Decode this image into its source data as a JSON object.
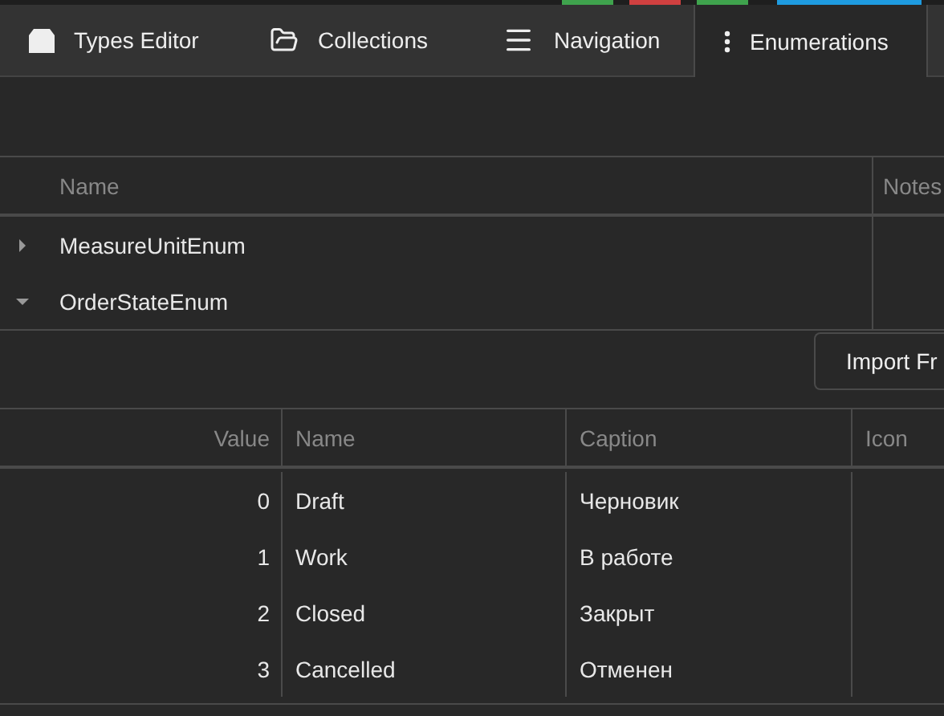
{
  "tabs": [
    {
      "label": "Types Editor",
      "selected": false
    },
    {
      "label": "Collections",
      "selected": false
    },
    {
      "label": "Navigation",
      "selected": false
    },
    {
      "label": "Enumerations",
      "selected": true
    }
  ],
  "enum_table": {
    "columns": [
      "Name",
      "Notes"
    ],
    "rows": [
      {
        "name": "MeasureUnitEnum",
        "expanded": false
      },
      {
        "name": "OrderStateEnum",
        "expanded": true
      }
    ]
  },
  "import_button": "Import Fr",
  "values_table": {
    "columns": [
      "Value",
      "Name",
      "Caption",
      "Icon"
    ],
    "rows": [
      {
        "value": "0",
        "name": "Draft",
        "caption": "Черновик"
      },
      {
        "value": "1",
        "name": "Work",
        "caption": "В работе"
      },
      {
        "value": "2",
        "name": "Closed",
        "caption": "Закрыт"
      },
      {
        "value": "3",
        "name": "Cancelled",
        "caption": "Отменен"
      }
    ]
  }
}
